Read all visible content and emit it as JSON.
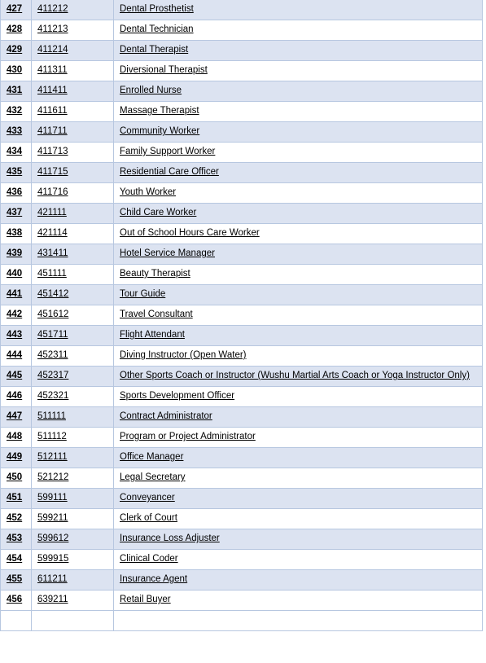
{
  "document": {
    "type": "occupation-list-table",
    "columns": [
      "index",
      "anzsco_code",
      "occupation_name"
    ],
    "first_visible_index": 427,
    "last_visible_index": 456
  },
  "table": {
    "rows": [
      {
        "index": "427",
        "code": "411212",
        "name": "Dental Prosthetist",
        "shaded": true
      },
      {
        "index": "428",
        "code": "411213",
        "name": "Dental Technician",
        "shaded": false
      },
      {
        "index": "429",
        "code": "411214",
        "name": "Dental Therapist",
        "shaded": true
      },
      {
        "index": "430",
        "code": "411311",
        "name": "Diversional Therapist",
        "shaded": false
      },
      {
        "index": "431",
        "code": "411411",
        "name": "Enrolled Nurse",
        "shaded": true
      },
      {
        "index": "432",
        "code": "411611",
        "name": "Massage Therapist",
        "shaded": false
      },
      {
        "index": "433",
        "code": "411711",
        "name": "Community Worker",
        "shaded": true
      },
      {
        "index": "434",
        "code": "411713",
        "name": "Family Support Worker",
        "shaded": false
      },
      {
        "index": "435",
        "code": "411715",
        "name": "Residential Care Officer",
        "shaded": true
      },
      {
        "index": "436",
        "code": "411716",
        "name": "Youth Worker",
        "shaded": false
      },
      {
        "index": "437",
        "code": "421111",
        "name": "Child Care Worker",
        "shaded": true
      },
      {
        "index": "438",
        "code": "421114",
        "name": "Out of School Hours Care Worker",
        "shaded": false
      },
      {
        "index": "439",
        "code": "431411",
        "name": "Hotel Service Manager",
        "shaded": true
      },
      {
        "index": "440",
        "code": "451111",
        "name": "Beauty Therapist",
        "shaded": false
      },
      {
        "index": "441",
        "code": "451412",
        "name": "Tour Guide",
        "shaded": true
      },
      {
        "index": "442",
        "code": "451612",
        "name": "Travel Consultant",
        "shaded": false
      },
      {
        "index": "443",
        "code": "451711",
        "name": "Flight Attendant",
        "shaded": true
      },
      {
        "index": "444",
        "code": "452311",
        "name": "Diving Instructor (Open Water)",
        "shaded": false
      },
      {
        "index": "445",
        "code": "452317",
        "name": "Other Sports Coach or Instructor (Wushu Martial Arts Coach or Yoga Instructor Only)",
        "shaded": true
      },
      {
        "index": "446",
        "code": "452321",
        "name": "Sports Development Officer",
        "shaded": false
      },
      {
        "index": "447",
        "code": "511111",
        "name": "Contract Administrator",
        "shaded": true
      },
      {
        "index": "448",
        "code": "511112",
        "name": "Program or Project Administrator",
        "shaded": false
      },
      {
        "index": "449",
        "code": "512111",
        "name": "Office Manager",
        "shaded": true
      },
      {
        "index": "450",
        "code": "521212",
        "name": "Legal Secretary",
        "shaded": false
      },
      {
        "index": "451",
        "code": "599111",
        "name": "Conveyancer",
        "shaded": true
      },
      {
        "index": "452",
        "code": "599211",
        "name": "Clerk of Court",
        "shaded": false
      },
      {
        "index": "453",
        "code": "599612",
        "name": "Insurance Loss Adjuster",
        "shaded": true
      },
      {
        "index": "454",
        "code": "599915",
        "name": "Clinical Coder",
        "shaded": false
      },
      {
        "index": "455",
        "code": "611211",
        "name": "Insurance Agent",
        "shaded": true
      },
      {
        "index": "456",
        "code": "639211",
        "name": "Retail Buyer",
        "shaded": false
      }
    ]
  },
  "colors": {
    "row_shaded": "#dce3f1",
    "row_plain": "#ffffff",
    "border": "#b7c7e0",
    "text": "#000000"
  }
}
